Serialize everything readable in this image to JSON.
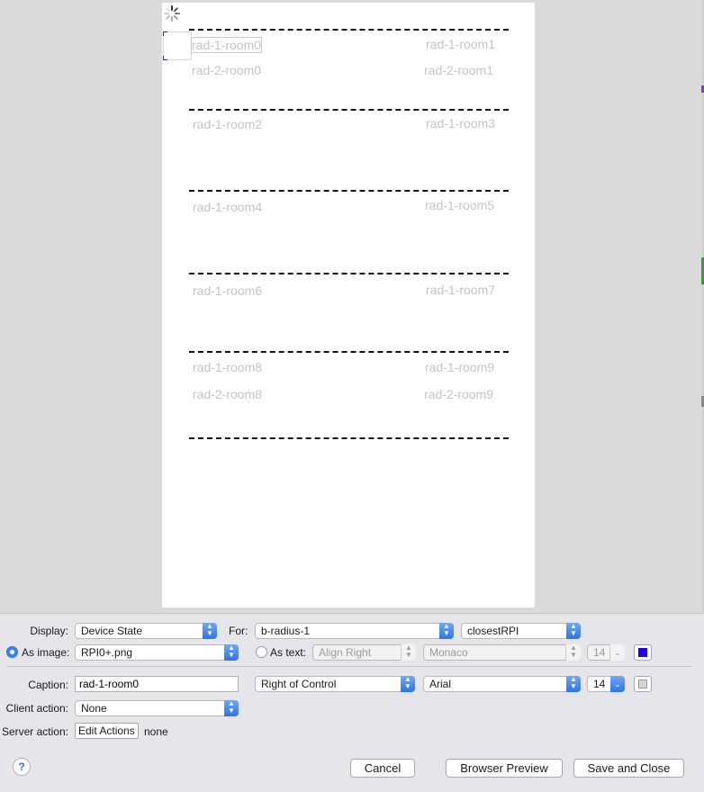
{
  "canvas": {
    "rooms": [
      {
        "id": "r1",
        "text": "rad-1-room0"
      },
      {
        "id": "r2",
        "text": "rad-1-room1"
      },
      {
        "id": "r3",
        "text": "rad-2-room0"
      },
      {
        "id": "r4",
        "text": "rad-2-room1"
      },
      {
        "id": "r5",
        "text": "rad-1-room2"
      },
      {
        "id": "r6",
        "text": "rad-1-room3"
      },
      {
        "id": "r7",
        "text": "rad-1-room4"
      },
      {
        "id": "r8",
        "text": "rad-1-room5"
      },
      {
        "id": "r9",
        "text": "rad-1-room6"
      },
      {
        "id": "r10",
        "text": "rad-1-room7"
      },
      {
        "id": "r11",
        "text": "rad-1-room8"
      },
      {
        "id": "r12",
        "text": "rad-1-room9"
      },
      {
        "id": "r13",
        "text": "rad-2-room8"
      },
      {
        "id": "r14",
        "text": "rad-2-room9"
      }
    ]
  },
  "panel": {
    "display_label": "Display:",
    "display_value": "Device State",
    "for_label": "For:",
    "for_device": "b-radius-1",
    "for_state": "closestRPI",
    "as_image_label": "As image:",
    "image_value": "RPI0+.png",
    "as_text_label": "As text:",
    "text_align": "Align Right",
    "text_font": "Monaco",
    "text_size": "14",
    "text_color": "#2200ee",
    "caption_label": "Caption:",
    "caption_value": "rad-1-room0",
    "caption_position": "Right of Control",
    "caption_font": "Arial",
    "caption_size": "14",
    "caption_color": "#d4d4d4",
    "client_action_label": "Client action:",
    "client_action_value": "None",
    "server_action_label": "Server action:",
    "edit_actions_label": "Edit Actions",
    "server_action_value": "none",
    "help_label": "?",
    "cancel_label": "Cancel",
    "preview_label": "Browser Preview",
    "save_label": "Save and Close"
  },
  "colors": {
    "accent": "#3b82f0",
    "canvas": "#ffffff",
    "room_text": "#c4c4c4"
  }
}
